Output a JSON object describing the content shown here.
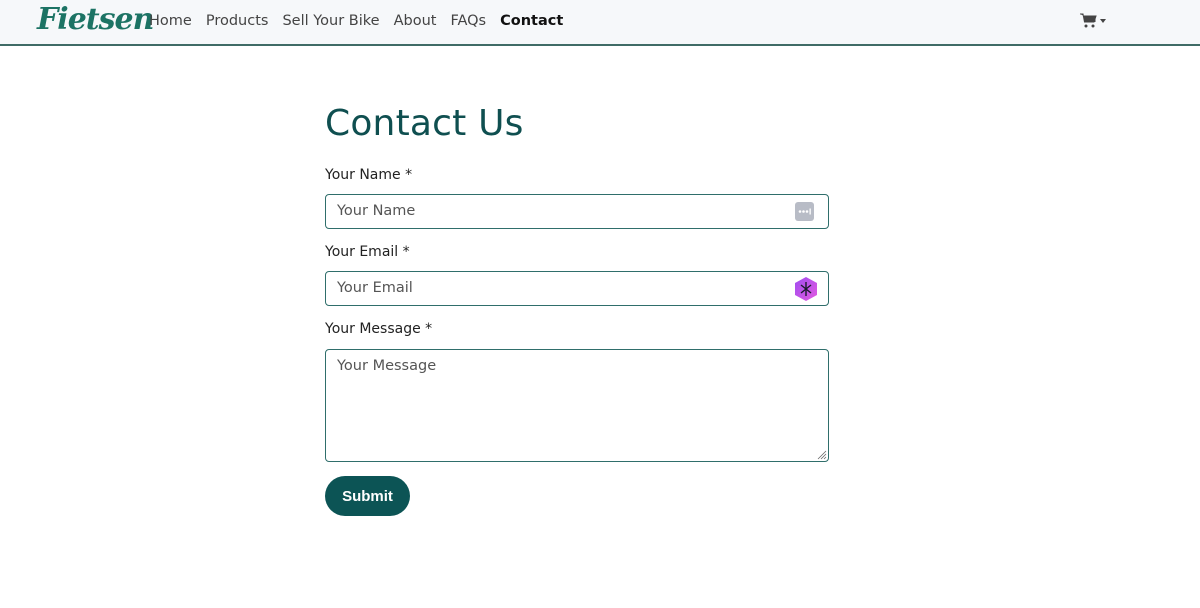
{
  "navbar": {
    "logo": "Fietsen",
    "links": [
      {
        "label": "Home",
        "active": false
      },
      {
        "label": "Products",
        "active": false
      },
      {
        "label": "Sell Your Bike",
        "active": false
      },
      {
        "label": "About",
        "active": false
      },
      {
        "label": "FAQs",
        "active": false
      },
      {
        "label": "Contact",
        "active": true
      }
    ],
    "cart_icon": "shopping-cart-icon"
  },
  "form": {
    "title": "Contact Us",
    "name": {
      "label": "Your Name *",
      "placeholder": "Your Name",
      "value": "",
      "icon": "password-manager-icon"
    },
    "email": {
      "label": "Your Email *",
      "placeholder": "Your Email",
      "value": "",
      "icon": "extension-hexagon-icon"
    },
    "message": {
      "label": "Your Message *",
      "placeholder": "Your Message",
      "value": ""
    },
    "submit_label": "Submit"
  },
  "colors": {
    "brand": "#1c7364",
    "primary": "#0c5455",
    "heading": "#0f4f50"
  }
}
